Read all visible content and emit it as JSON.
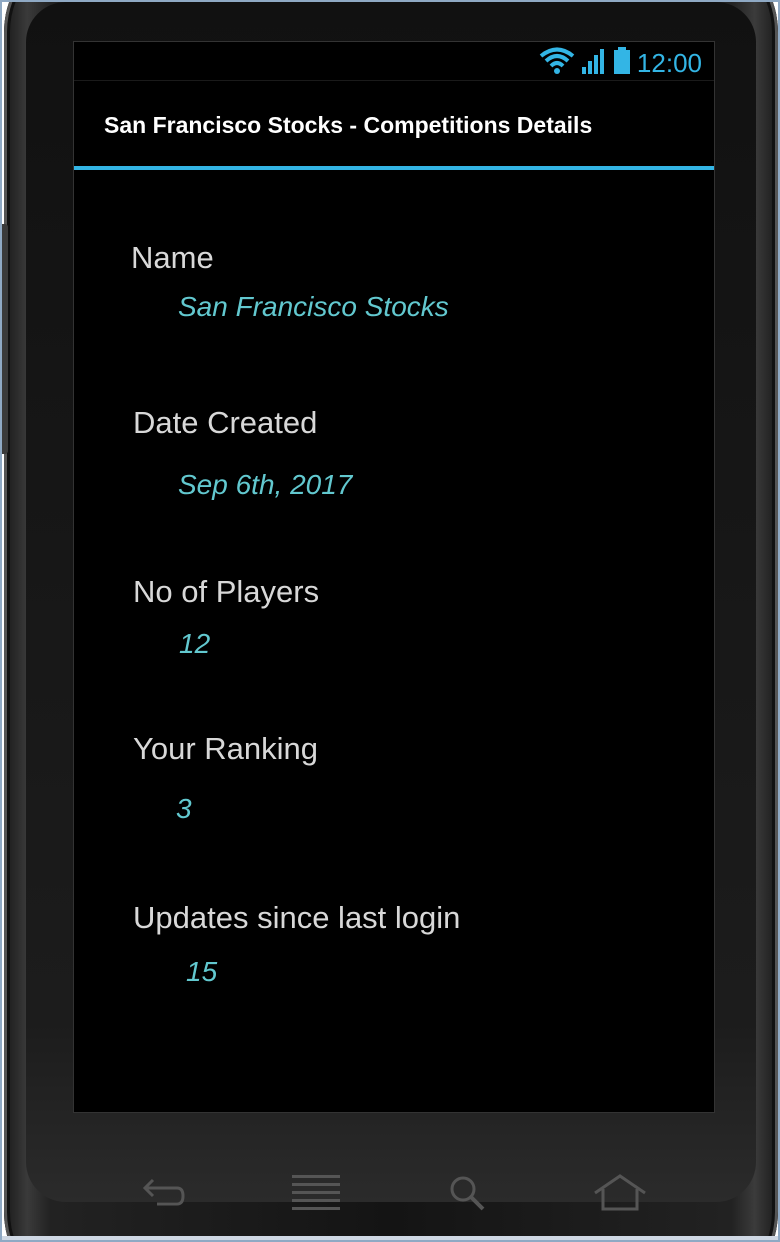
{
  "status_bar": {
    "time": "12:00",
    "icons": [
      "wifi-icon",
      "signal-icon",
      "battery-icon"
    ],
    "accent_color": "#33b5e5"
  },
  "action_bar": {
    "title": "San Francisco Stocks - Competitions Details"
  },
  "details": [
    {
      "label": "Name",
      "value": "San Francisco Stocks"
    },
    {
      "label": "Date Created",
      "value": "Sep 6th, 2017"
    },
    {
      "label": "No of Players",
      "value": "12"
    },
    {
      "label": "Your Ranking",
      "value": "3"
    },
    {
      "label": "Updates since last login",
      "value": "15"
    }
  ],
  "nav_buttons": [
    "back-icon",
    "menu-icon",
    "search-icon",
    "home-icon"
  ],
  "colors": {
    "label": "#d8d8d8",
    "value": "#62c8cf",
    "background": "#000000"
  }
}
